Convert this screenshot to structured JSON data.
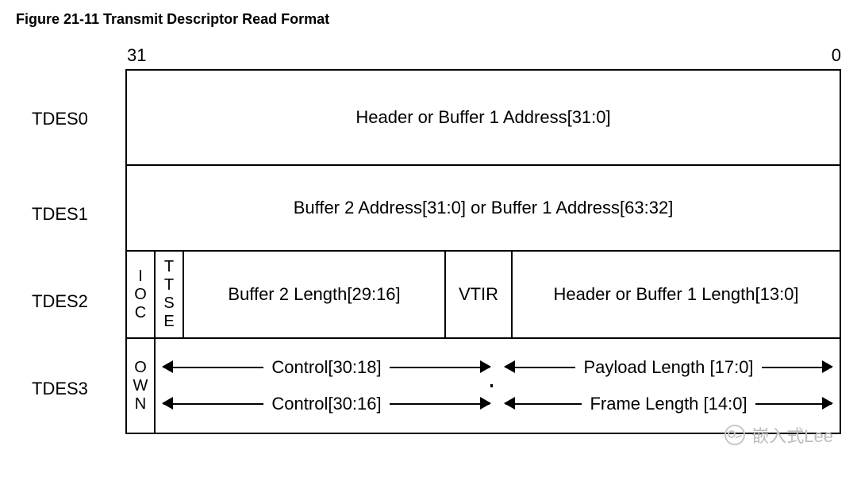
{
  "title": "Figure 21-11  Transmit Descriptor Read Format",
  "bits": {
    "msb": "31",
    "lsb": "0"
  },
  "rows": {
    "tdes0": {
      "label": "TDES0",
      "content": "Header or Buffer 1 Address[31:0]"
    },
    "tdes1": {
      "label": "TDES1",
      "content": "Buffer 2 Address[31:0] or Buffer 1 Address[63:32]"
    },
    "tdes2": {
      "label": "TDES2",
      "ioc": "I\nO\nC",
      "ttse": "T\nT\nS\nE",
      "buf2len": "Buffer 2 Length[29:16]",
      "vtir": "VTIR",
      "hbuf1len": "Header or Buffer 1 Length[13:0]"
    },
    "tdes3": {
      "label": "TDES3",
      "own": "O\nW\nN",
      "top_left": "Control[30:16]",
      "top_right": "Frame Length [14:0]",
      "bot_left": "Control[30:18]",
      "bot_right": "Payload Length [17:0]"
    }
  },
  "watermark": "嵌入式Lee"
}
